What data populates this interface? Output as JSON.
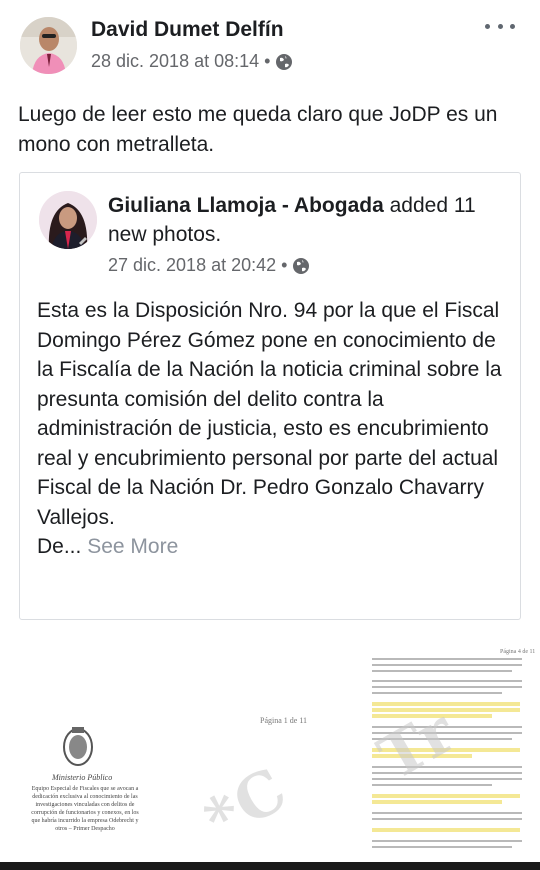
{
  "post": {
    "author": "David Dumet Delfín",
    "timestamp": "28 dic. 2018 at 08:14 •",
    "privacy_icon": "globe-icon",
    "text": "Luego de leer esto me queda claro que JoDP es un mono con metralleta."
  },
  "shared": {
    "author": "Giuliana Llamoja - Abogada",
    "action": "added 11 new photos.",
    "timestamp": "27 dic. 2018 at 20:42 •",
    "privacy_icon": "globe-icon",
    "text": "Esta es la Disposición Nro. 94 por la que el Fiscal Domingo Pérez Gómez pone en conocimiento de la Fiscalía de la Nación la noticia criminal sobre la presunta comisión del delito contra la administración de justicia, esto es encubrimiento real y encubrimiento personal por parte del actual Fiscal de la Nación Dr. Pedro Gonzalo Chavarry Vallejos.",
    "truncated": "De...",
    "see_more": "See More"
  },
  "photos": {
    "left_doc": {
      "seal_text": "Ministerio Público",
      "caption": "Equipo Especial de Fiscales que se avocan a dedicación exclusiva al conocimiento de las investigaciones vinculadas con delitos de corrupción de funcionarios y conexos, en los que habría incurrido la empresa Odebrecht y otros – Primer Despacho"
    },
    "mid_doc": {
      "page_label": "Página 1 de 11"
    },
    "right_doc": {
      "page_label": "Página 4 de 11"
    }
  }
}
